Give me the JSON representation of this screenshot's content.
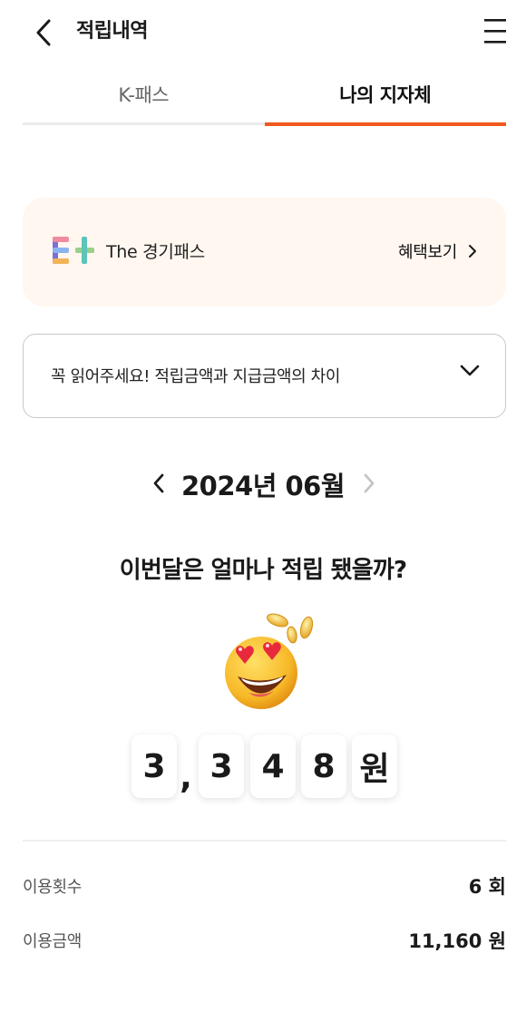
{
  "header": {
    "title": "적립내역",
    "back_icon": "chevron-left-icon",
    "menu_icon": "hamburger-menu-icon"
  },
  "tabs": [
    {
      "label": "K-패스",
      "active": false
    },
    {
      "label": "나의 지자체",
      "active": true
    }
  ],
  "colors": {
    "accent": "#f2591c",
    "card_bg": "#fff7f0",
    "text": "#1a1a1a"
  },
  "benefit_card": {
    "brand_name": "The 경기패스",
    "link_label": "혜택보기",
    "logo_icon": "gyeonggi-pass-logo"
  },
  "notice": {
    "text": "꼭 읽어주세요! 적립금액과 지급금액의 차이",
    "expand_icon": "chevron-down-icon"
  },
  "month_nav": {
    "label": "2024년 06월",
    "prev_icon": "chevron-left-icon",
    "next_icon": "chevron-right-icon",
    "next_enabled": false
  },
  "summary": {
    "question": "이번달은 얼마나 적립 됐을까?",
    "emoji": "heart-eyes-coins-emoji",
    "digits": [
      "3",
      ",",
      "3",
      "4",
      "8",
      "원"
    ]
  },
  "stats": {
    "count_label": "이용횟수",
    "count_value": "6 회",
    "amount_label": "이용금액",
    "amount_value": "11,160 원"
  }
}
